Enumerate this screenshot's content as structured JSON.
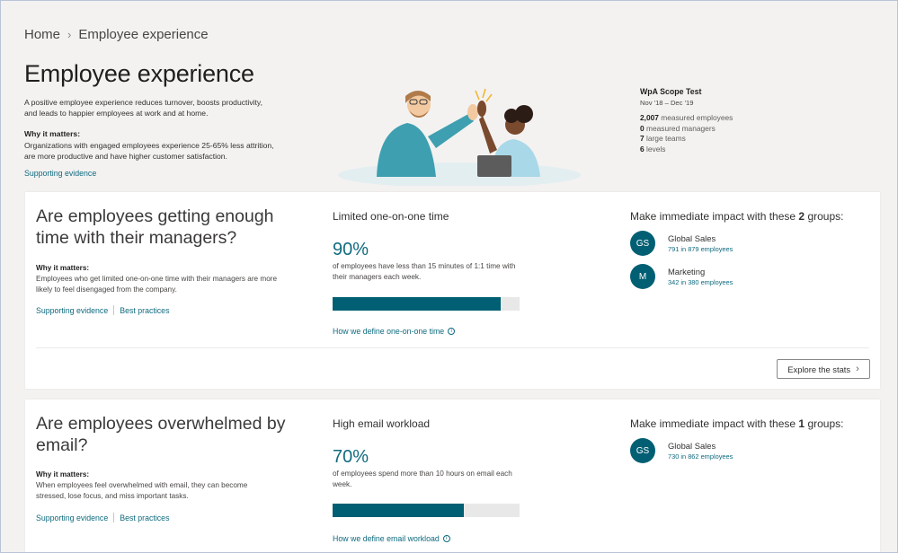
{
  "breadcrumb": {
    "home": "Home",
    "current": "Employee experience"
  },
  "page": {
    "title": "Employee experience",
    "intro": "A positive employee experience reduces turnover, boosts productivity, and leads to happier employees at work and at home.",
    "why_heading": "Why it matters:",
    "why_body": "Organizations with engaged employees experience 25-65% less attrition, are more productive and have higher customer satisfaction.",
    "supporting_evidence": "Supporting evidence"
  },
  "scope": {
    "title": "WpA Scope Test",
    "dates": "Nov '18 – Dec '19",
    "stats": [
      {
        "num": "2,007",
        "label": "measured employees"
      },
      {
        "num": "0",
        "label": "measured managers"
      },
      {
        "num": "7",
        "label": "large teams"
      },
      {
        "num": "6",
        "label": "levels"
      }
    ]
  },
  "cards": [
    {
      "question": "Are employees getting enough time with their managers?",
      "why_heading": "Why it matters:",
      "why_body": "Employees who get limited one-on-one time with their managers are more likely to feel disengaged from the company.",
      "supporting_evidence": "Supporting evidence",
      "best_practices": "Best practices",
      "metric_title": "Limited one-on-one time",
      "metric_value": "90%",
      "metric_desc": "of employees have less than 15 minutes of 1:1 time with their managers each week.",
      "progress": 0.9,
      "define_link": "How we define one-on-one time",
      "impact_prefix": "Make immediate impact with these",
      "impact_count": "2",
      "impact_suffix": "groups:",
      "groups": [
        {
          "initials": "GS",
          "name": "Global Sales",
          "detail": "791 in 879 employees"
        },
        {
          "initials": "M",
          "name": "Marketing",
          "detail": "342 in 380 employees"
        }
      ],
      "explore": "Explore the stats"
    },
    {
      "question": "Are employees overwhelmed by email?",
      "why_heading": "Why it matters:",
      "why_body": "When employees feel overwhelmed with email, they can become stressed, lose focus, and miss important tasks.",
      "supporting_evidence": "Supporting evidence",
      "best_practices": "Best practices",
      "metric_title": "High email workload",
      "metric_value": "70%",
      "metric_desc": "of employees spend more than 10 hours on email each week.",
      "progress": 0.7,
      "define_link": "How we define email workload",
      "impact_prefix": "Make immediate impact with these",
      "impact_count": "1",
      "impact_suffix": "groups:",
      "groups": [
        {
          "initials": "GS",
          "name": "Global Sales",
          "detail": "730 in 862 employees"
        }
      ]
    }
  ],
  "colors": {
    "accent": "#005f73",
    "link": "#0f6a7f",
    "bar_bg": "#e8e8e8"
  }
}
